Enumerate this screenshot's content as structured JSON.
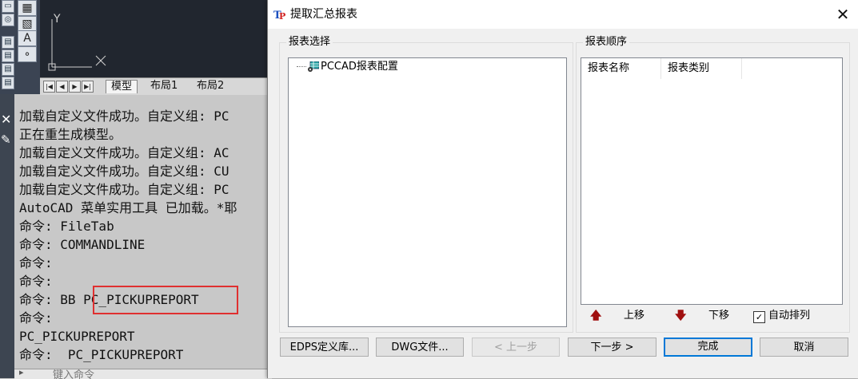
{
  "autocad": {
    "layout_tabs": [
      "模型",
      "布局1",
      "布局2"
    ],
    "axis_label": "Y",
    "command_history": [
      "加载自定义文件成功。自定义组: PC",
      "正在重生成模型。",
      "加载自定义文件成功。自定义组: AC",
      "加载自定义文件成功。自定义组: CU",
      "加载自定义文件成功。自定义组: PC",
      "AutoCAD 菜单实用工具 已加载。*耶",
      "命令: FileTab",
      "命令: COMMANDLINE",
      "命令:",
      "命令:",
      "命令: BB PC_PICKUPREPORT",
      "命令:",
      "PC_PICKUPREPORT",
      "命令:  PC_PICKUPREPORT"
    ],
    "command_input_placeholder": "键入命令"
  },
  "dialog": {
    "title": "提取汇总报表",
    "close_glyph": "✕",
    "left_group_label": "报表选择",
    "tree_item": "PCCAD报表配置",
    "right_group_label": "报表顺序",
    "columns": [
      "报表名称",
      "报表类别"
    ],
    "move_up": "上移",
    "move_down": "下移",
    "auto_sort": "自动排列",
    "auto_sort_checked": true,
    "buttons": {
      "edps": "EDPS定义库...",
      "dwg": "DWG文件...",
      "prev": "< 上一步",
      "next": "下一步 >",
      "finish": "完成",
      "cancel": "取消"
    }
  }
}
